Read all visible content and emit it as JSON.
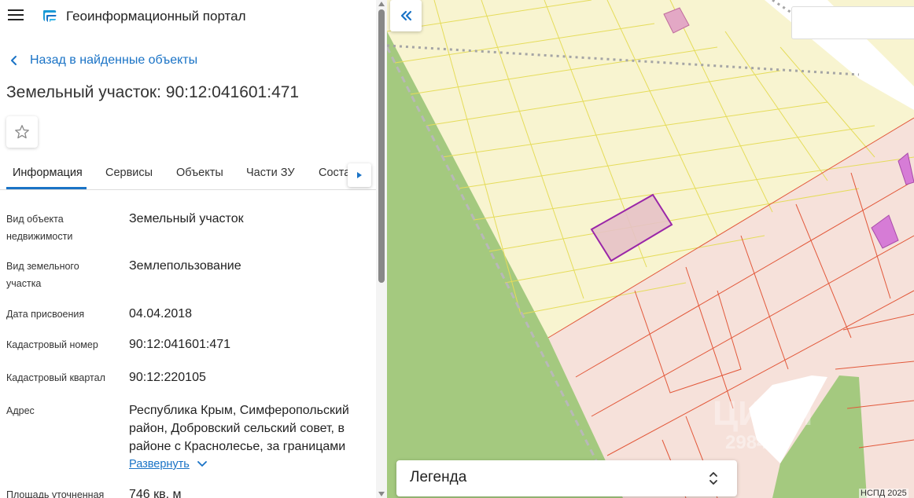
{
  "header": {
    "app_title": "Геоинформационный портал"
  },
  "back_link": {
    "label": "Назад в найденные объекты"
  },
  "object": {
    "title": "Земельный участок: 90:12:041601:471"
  },
  "tabs": [
    {
      "label": "Информация",
      "active": true
    },
    {
      "label": "Сервисы",
      "active": false
    },
    {
      "label": "Объекты",
      "active": false
    },
    {
      "label": "Части ЗУ",
      "active": false
    },
    {
      "label": "Соста",
      "active": false
    }
  ],
  "properties": [
    {
      "label": "Вид объекта недвижимости",
      "value": "Земельный участок"
    },
    {
      "label": "Вид земельного участка",
      "value": "Землепользование"
    },
    {
      "label": "Дата присвоения",
      "value": "04.04.2018"
    },
    {
      "label": "Кадастровый номер",
      "value": "90:12:041601:471"
    },
    {
      "label": "Кадастровый квартал",
      "value": "90:12:220105"
    },
    {
      "label": "Адрес",
      "value": "Республика Крым, Симферопольский район, Добровский сельский совет, в районе с Краснолесье, за границами"
    },
    {
      "label": "Площадь уточненная",
      "value": "746 кв. м"
    }
  ],
  "expand_label": "Развернуть",
  "map": {
    "legend_label": "Легенда",
    "attribution": "НСПД 2025",
    "watermark": "ЦИАН",
    "watermark_number": "2984"
  },
  "icons": {
    "menu": "hamburger-icon",
    "logo": "portal-logo-icon",
    "back": "chevron-left-icon",
    "favorite": "star-icon",
    "tabs_more": "caret-right-icon",
    "collapse": "double-chevron-left-icon",
    "expand": "chevron-down-icon",
    "legend_toggle": "unfold-icon"
  },
  "colors": {
    "accent": "#1a73c6",
    "map_yellow": "#f8f4d0",
    "map_pink": "#f6e1da",
    "map_green": "#a4c97f",
    "selected_parcel": "#9a26a8"
  }
}
